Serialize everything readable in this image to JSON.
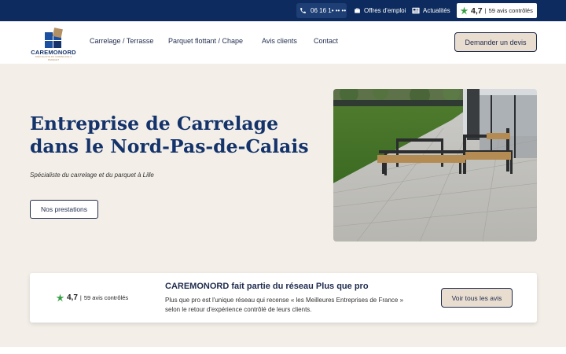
{
  "topbar": {
    "phone": "06 16 1• •• ••",
    "jobs": "Offres d'emploi",
    "news": "Actualités",
    "rating_score": "4,7",
    "rating_sep": "|",
    "rating_count": "59 avis contrôlés"
  },
  "header": {
    "logo_text": "CAREMONORD",
    "logo_sub": "SPÉCIALISTE DU CARRELAGE & PARQUET",
    "nav": [
      "Carrelage / Terrasse",
      "Parquet flottant / Chape",
      "Avis clients",
      "Contact"
    ],
    "cta": "Demander un devis"
  },
  "hero": {
    "title": "Entreprise de Carrelage dans le Nord-Pas-de-Calais",
    "subtitle": "Spécialiste du carrelage et du parquet à Lille",
    "button": "Nos prestations"
  },
  "card": {
    "rating_score": "4,7",
    "rating_sep": "|",
    "rating_count": "59 avis contrôlés",
    "title": "CAREMONORD fait partie du réseau Plus que pro",
    "text": "Plus que pro est l'unique réseau qui recense « les Meilleures Entreprises de France » selon le retour d'expérience contrôlé de leurs clients.",
    "button": "Voir tous les avis"
  },
  "colors": {
    "navy": "#0d2b5e",
    "title_blue": "#14336b",
    "beige_bg": "#f3efe8",
    "button_beige": "#e9ddd0",
    "rating_green": "#2e9e3f"
  }
}
